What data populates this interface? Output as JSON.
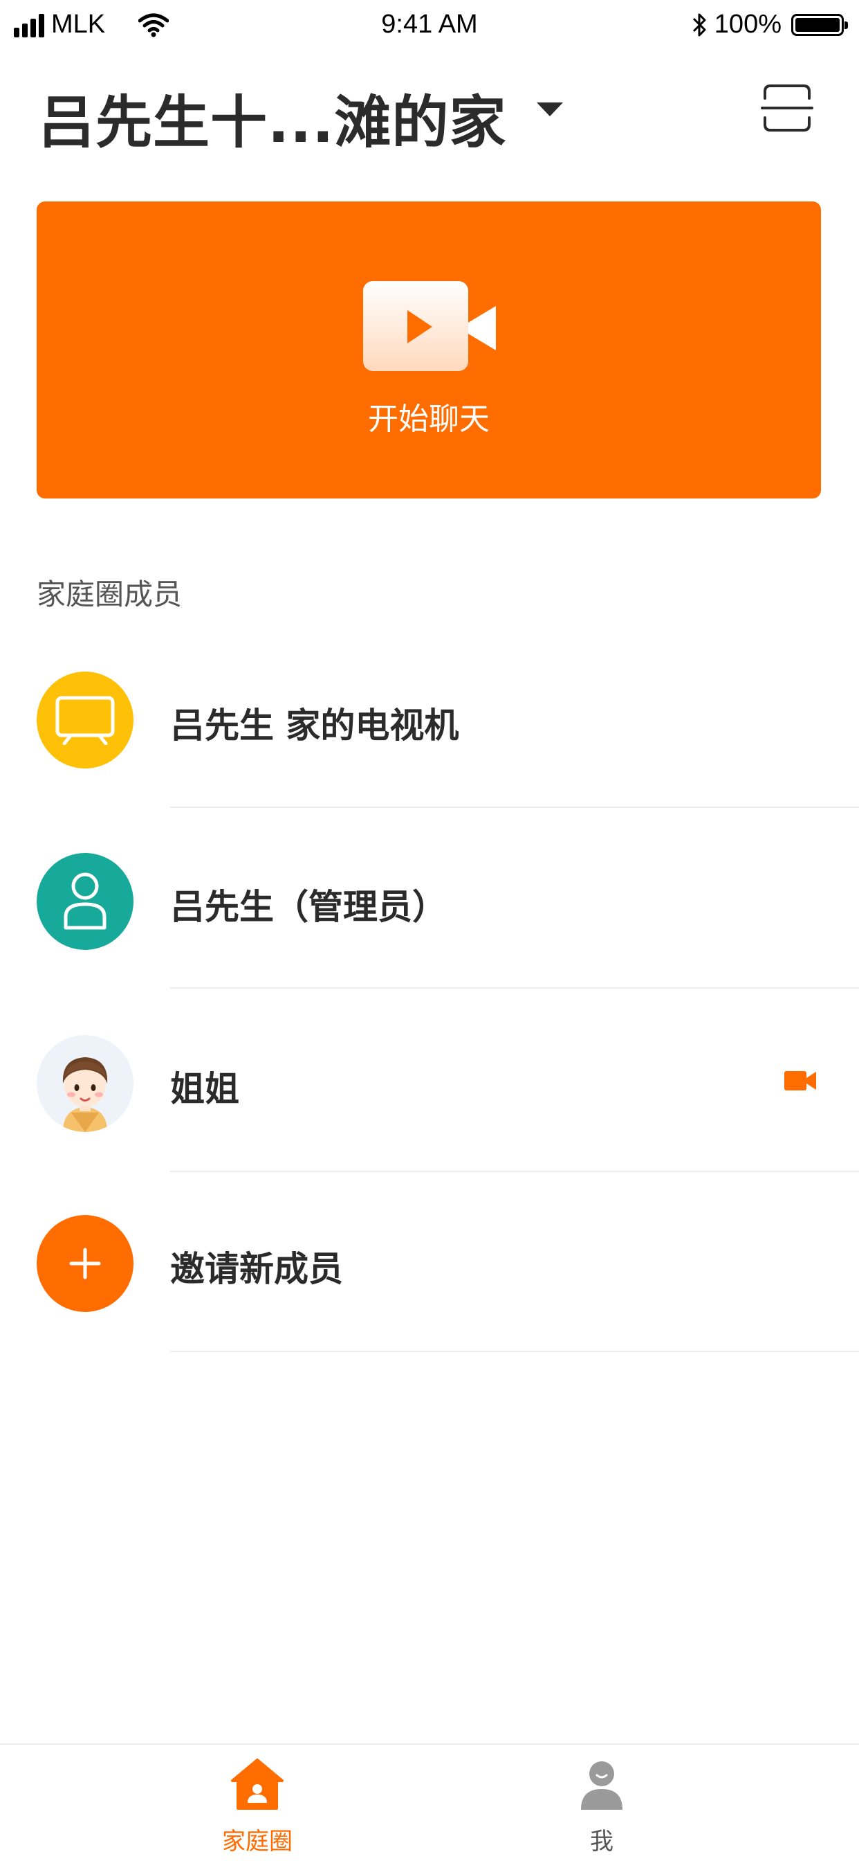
{
  "status_bar": {
    "carrier": "MLK",
    "time": "9:41 AM",
    "battery": "100%"
  },
  "header": {
    "title": "吕先生十...滩的家",
    "dropdown_icon": "caret-down-icon",
    "scan_icon": "scan-icon"
  },
  "chat_card": {
    "label": "开始聊天",
    "icon": "video-camera-icon",
    "color": "#ff6c00"
  },
  "members_section": {
    "label": "家庭圈成员",
    "items": [
      {
        "name": "吕先生 家的电视机",
        "avatar_icon": "tv-icon",
        "avatar_color": "#ffc107"
      },
      {
        "name": "吕先生（管理员）",
        "avatar_icon": "person-icon",
        "avatar_color": "#17a99a"
      },
      {
        "name": "姐姐",
        "avatar_icon": "girl-avatar",
        "action_icon": "video-call-icon"
      },
      {
        "name": "邀请新成员",
        "avatar_icon": "plus-icon",
        "avatar_color": "#ff6c00"
      }
    ]
  },
  "tab_bar": {
    "tabs": [
      {
        "label": "家庭圈",
        "icon": "home-icon",
        "active": true
      },
      {
        "label": "我",
        "icon": "profile-icon",
        "active": false
      }
    ],
    "active_color": "#ff6c00",
    "inactive_color": "#555555"
  }
}
